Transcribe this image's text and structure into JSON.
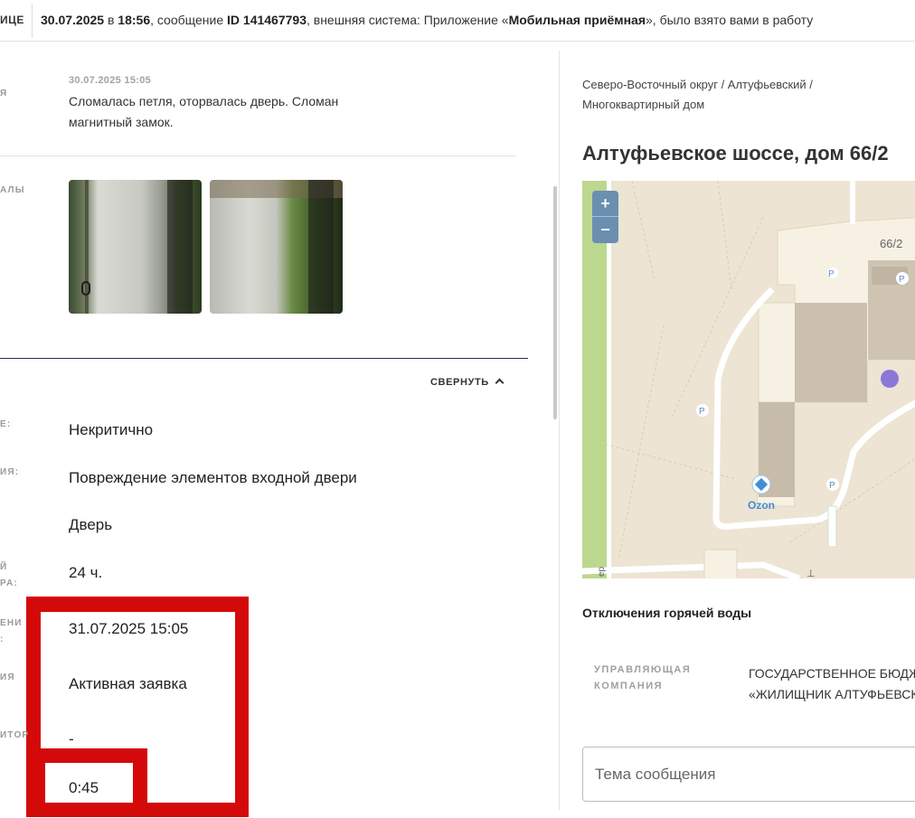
{
  "topbar": {
    "cut_label": "ИЦЕ",
    "date": "30.07.2025",
    "word_at": "в",
    "time": "18:56",
    "text_message": ", сообщение",
    "message_id": "ID 141467793",
    "text_system": ", внешняя система: Приложение «",
    "app_name": "Мобильная приёмная",
    "text_end": "», было взято вами в работу"
  },
  "comment": {
    "cut_label": "Я",
    "date": "30.07.2025 15:05",
    "text": "Сломалась петля, оторвалась дверь. Сломан магнитный замок."
  },
  "files": {
    "cut_label": "АЛЫ"
  },
  "details": {
    "collapse_label": "СВЕРНУТЬ",
    "rows": [
      {
        "cut_label": "Е:",
        "value": "Некритично"
      },
      {
        "cut_label": "ИЯ:",
        "value": "Повреждение элементов входной двери"
      },
      {
        "cut_label": "",
        "value": "Дверь"
      },
      {
        "cut_label_1": "Й",
        "cut_label_2": "РА:",
        "value": "24 ч."
      },
      {
        "cut_label_1": "ЕНИ",
        "cut_label_2": ":",
        "value": "31.07.2025 15:05"
      },
      {
        "cut_label": "ИЯ",
        "value": "Активная заявка"
      },
      {
        "cut_label": "ИТОР",
        "value": "-"
      },
      {
        "cut_label": "",
        "value": "0:45"
      }
    ]
  },
  "address": {
    "breadcrumb": "Северо-Восточный округ / Алтуфьевский / Многоквартирный дом",
    "title": "Алтуфьевское шоссе, дом 66/2"
  },
  "map": {
    "zoom_in": "+",
    "zoom_out": "−",
    "building_label": "66/2",
    "poi_label": "Ozon",
    "parking_label": "P",
    "street_fragment": "ер",
    "marker_color": "#8b78d6"
  },
  "hot_water": {
    "title": "Отключения горячей воды"
  },
  "management": {
    "label_line1": "УПРАВЛЯЮЩАЯ",
    "label_line2": "КОМПАНИЯ",
    "value_line1": "ГОСУДАРСТВЕННОЕ БЮДЖЕТНОЕ",
    "value_line2": "«ЖИЛИЩНИК АЛТУФЬЕВСКОГО"
  },
  "subject": {
    "placeholder": "Тема сообщения"
  },
  "colors": {
    "highlight": "#d40a0a",
    "divider_dark": "#2b2b5c",
    "map_bg": "#ede4d3",
    "zoom_bg": "#6b8fb0"
  }
}
